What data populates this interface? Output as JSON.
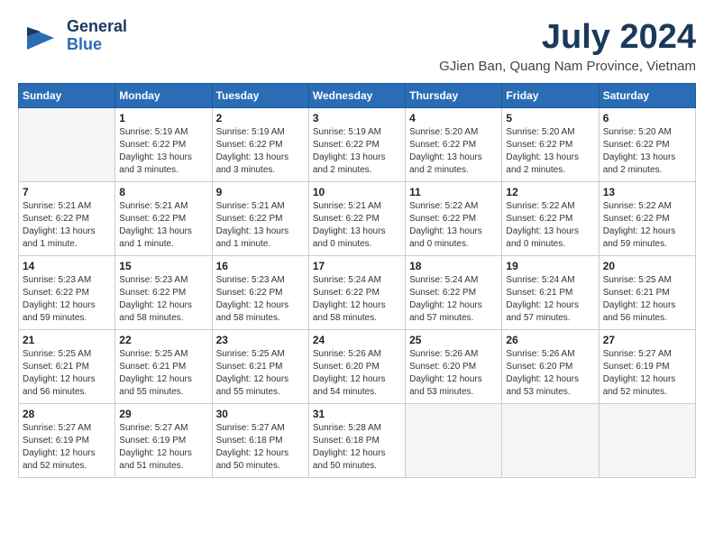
{
  "header": {
    "logo_general": "General",
    "logo_blue": "Blue",
    "month_title": "July 2024",
    "location": "GJien Ban, Quang Nam Province, Vietnam"
  },
  "calendar": {
    "days_of_week": [
      "Sunday",
      "Monday",
      "Tuesday",
      "Wednesday",
      "Thursday",
      "Friday",
      "Saturday"
    ],
    "weeks": [
      [
        {
          "day": "",
          "info": ""
        },
        {
          "day": "1",
          "info": "Sunrise: 5:19 AM\nSunset: 6:22 PM\nDaylight: 13 hours\nand 3 minutes."
        },
        {
          "day": "2",
          "info": "Sunrise: 5:19 AM\nSunset: 6:22 PM\nDaylight: 13 hours\nand 3 minutes."
        },
        {
          "day": "3",
          "info": "Sunrise: 5:19 AM\nSunset: 6:22 PM\nDaylight: 13 hours\nand 2 minutes."
        },
        {
          "day": "4",
          "info": "Sunrise: 5:20 AM\nSunset: 6:22 PM\nDaylight: 13 hours\nand 2 minutes."
        },
        {
          "day": "5",
          "info": "Sunrise: 5:20 AM\nSunset: 6:22 PM\nDaylight: 13 hours\nand 2 minutes."
        },
        {
          "day": "6",
          "info": "Sunrise: 5:20 AM\nSunset: 6:22 PM\nDaylight: 13 hours\nand 2 minutes."
        }
      ],
      [
        {
          "day": "7",
          "info": "Sunrise: 5:21 AM\nSunset: 6:22 PM\nDaylight: 13 hours\nand 1 minute."
        },
        {
          "day": "8",
          "info": "Sunrise: 5:21 AM\nSunset: 6:22 PM\nDaylight: 13 hours\nand 1 minute."
        },
        {
          "day": "9",
          "info": "Sunrise: 5:21 AM\nSunset: 6:22 PM\nDaylight: 13 hours\nand 1 minute."
        },
        {
          "day": "10",
          "info": "Sunrise: 5:21 AM\nSunset: 6:22 PM\nDaylight: 13 hours\nand 0 minutes."
        },
        {
          "day": "11",
          "info": "Sunrise: 5:22 AM\nSunset: 6:22 PM\nDaylight: 13 hours\nand 0 minutes."
        },
        {
          "day": "12",
          "info": "Sunrise: 5:22 AM\nSunset: 6:22 PM\nDaylight: 13 hours\nand 0 minutes."
        },
        {
          "day": "13",
          "info": "Sunrise: 5:22 AM\nSunset: 6:22 PM\nDaylight: 12 hours\nand 59 minutes."
        }
      ],
      [
        {
          "day": "14",
          "info": "Sunrise: 5:23 AM\nSunset: 6:22 PM\nDaylight: 12 hours\nand 59 minutes."
        },
        {
          "day": "15",
          "info": "Sunrise: 5:23 AM\nSunset: 6:22 PM\nDaylight: 12 hours\nand 58 minutes."
        },
        {
          "day": "16",
          "info": "Sunrise: 5:23 AM\nSunset: 6:22 PM\nDaylight: 12 hours\nand 58 minutes."
        },
        {
          "day": "17",
          "info": "Sunrise: 5:24 AM\nSunset: 6:22 PM\nDaylight: 12 hours\nand 58 minutes."
        },
        {
          "day": "18",
          "info": "Sunrise: 5:24 AM\nSunset: 6:22 PM\nDaylight: 12 hours\nand 57 minutes."
        },
        {
          "day": "19",
          "info": "Sunrise: 5:24 AM\nSunset: 6:21 PM\nDaylight: 12 hours\nand 57 minutes."
        },
        {
          "day": "20",
          "info": "Sunrise: 5:25 AM\nSunset: 6:21 PM\nDaylight: 12 hours\nand 56 minutes."
        }
      ],
      [
        {
          "day": "21",
          "info": "Sunrise: 5:25 AM\nSunset: 6:21 PM\nDaylight: 12 hours\nand 56 minutes."
        },
        {
          "day": "22",
          "info": "Sunrise: 5:25 AM\nSunset: 6:21 PM\nDaylight: 12 hours\nand 55 minutes."
        },
        {
          "day": "23",
          "info": "Sunrise: 5:25 AM\nSunset: 6:21 PM\nDaylight: 12 hours\nand 55 minutes."
        },
        {
          "day": "24",
          "info": "Sunrise: 5:26 AM\nSunset: 6:20 PM\nDaylight: 12 hours\nand 54 minutes."
        },
        {
          "day": "25",
          "info": "Sunrise: 5:26 AM\nSunset: 6:20 PM\nDaylight: 12 hours\nand 53 minutes."
        },
        {
          "day": "26",
          "info": "Sunrise: 5:26 AM\nSunset: 6:20 PM\nDaylight: 12 hours\nand 53 minutes."
        },
        {
          "day": "27",
          "info": "Sunrise: 5:27 AM\nSunset: 6:19 PM\nDaylight: 12 hours\nand 52 minutes."
        }
      ],
      [
        {
          "day": "28",
          "info": "Sunrise: 5:27 AM\nSunset: 6:19 PM\nDaylight: 12 hours\nand 52 minutes."
        },
        {
          "day": "29",
          "info": "Sunrise: 5:27 AM\nSunset: 6:19 PM\nDaylight: 12 hours\nand 51 minutes."
        },
        {
          "day": "30",
          "info": "Sunrise: 5:27 AM\nSunset: 6:18 PM\nDaylight: 12 hours\nand 50 minutes."
        },
        {
          "day": "31",
          "info": "Sunrise: 5:28 AM\nSunset: 6:18 PM\nDaylight: 12 hours\nand 50 minutes."
        },
        {
          "day": "",
          "info": ""
        },
        {
          "day": "",
          "info": ""
        },
        {
          "day": "",
          "info": ""
        }
      ]
    ]
  }
}
